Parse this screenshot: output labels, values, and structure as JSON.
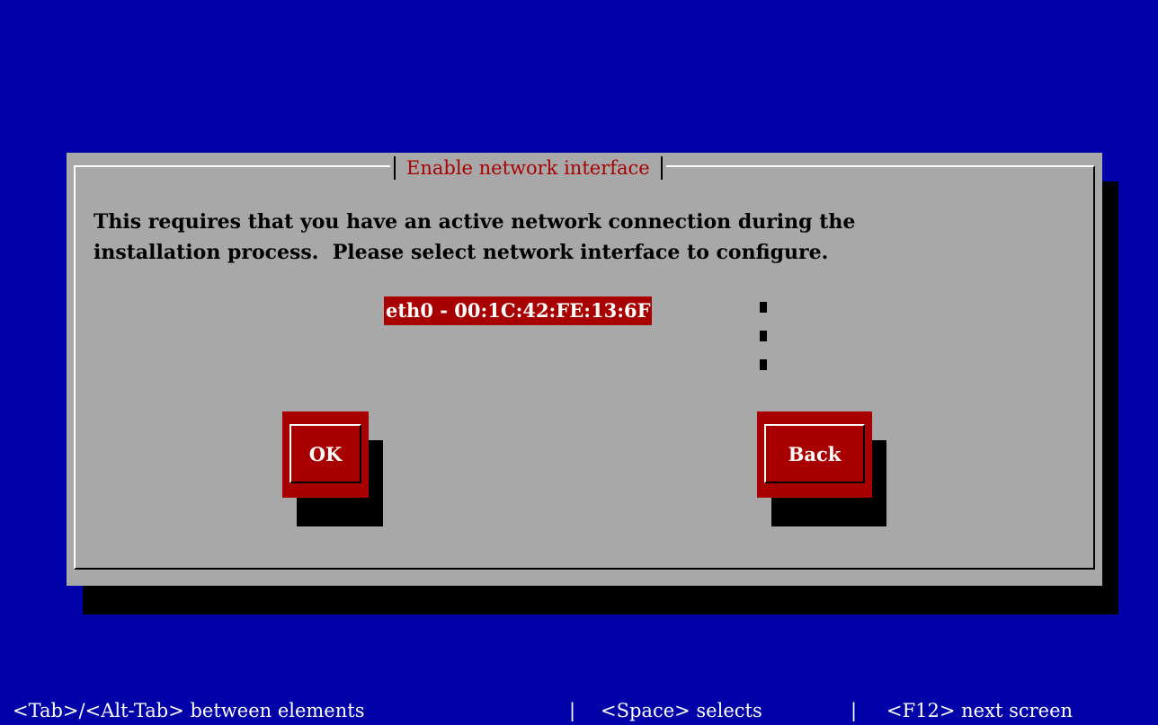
{
  "dialog": {
    "title": "Enable network interface",
    "message_lines": [
      "This requires that you have an active network connection during the",
      "installation process.  Please select network interface to configure."
    ],
    "interfaces": [
      "eth0 - 00:1C:42:FE:13:6F"
    ],
    "selected_interface": "eth0 - 00:1C:42:FE:13:6F",
    "buttons": {
      "ok_label": "OK",
      "back_label": "Back"
    }
  },
  "footer": {
    "hint_tab": "<Tab>/<Alt-Tab> between elements",
    "separator": "|",
    "hint_space": "<Space> selects",
    "hint_f12": "<F12> next screen"
  },
  "colors": {
    "background": "#0000a8",
    "dialog": "#a8a8a8",
    "accent": "#a80000",
    "text": "#000000",
    "highlight_text": "#ffffff"
  }
}
